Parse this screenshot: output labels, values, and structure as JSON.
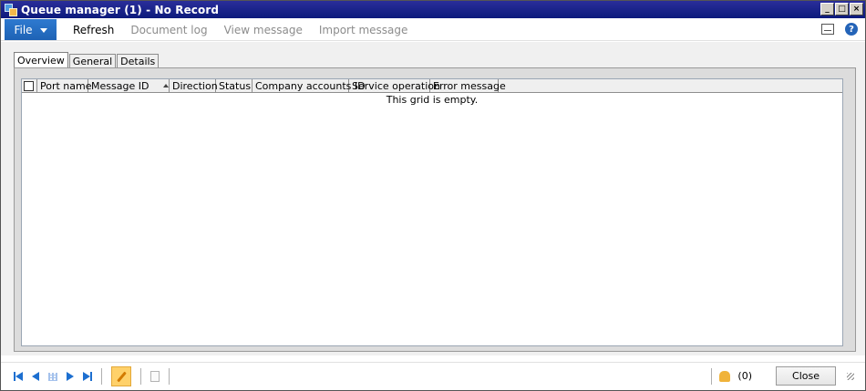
{
  "window": {
    "title": "Queue manager (1) - No Record"
  },
  "window_controls": {
    "minimize": "_",
    "maximize": "□",
    "close": "×"
  },
  "actionbar": {
    "file_label": "File",
    "items": [
      {
        "label": "Refresh",
        "enabled": true
      },
      {
        "label": "Document log",
        "enabled": false
      },
      {
        "label": "View message",
        "enabled": false
      },
      {
        "label": "Import message",
        "enabled": false
      }
    ],
    "help_glyph": "?"
  },
  "tabs": [
    {
      "label": "Overview",
      "active": true
    },
    {
      "label": "General",
      "active": false
    },
    {
      "label": "Details",
      "active": false
    }
  ],
  "grid": {
    "columns": [
      "Port name",
      "Message ID",
      "Direction",
      "Status",
      "Company accounts ID",
      "Service operation",
      "Error message"
    ],
    "sorted_column": "Message ID",
    "sort_direction": "ascending",
    "empty_text": "This grid is empty."
  },
  "statusbar": {
    "notification_count": "(0)",
    "close_label": "Close"
  },
  "colors": {
    "titlebar": "#0c1a7c",
    "file_button": "#1e62b5",
    "nav_arrows": "#1d6fd0",
    "edit_button": "#ffd16a"
  }
}
